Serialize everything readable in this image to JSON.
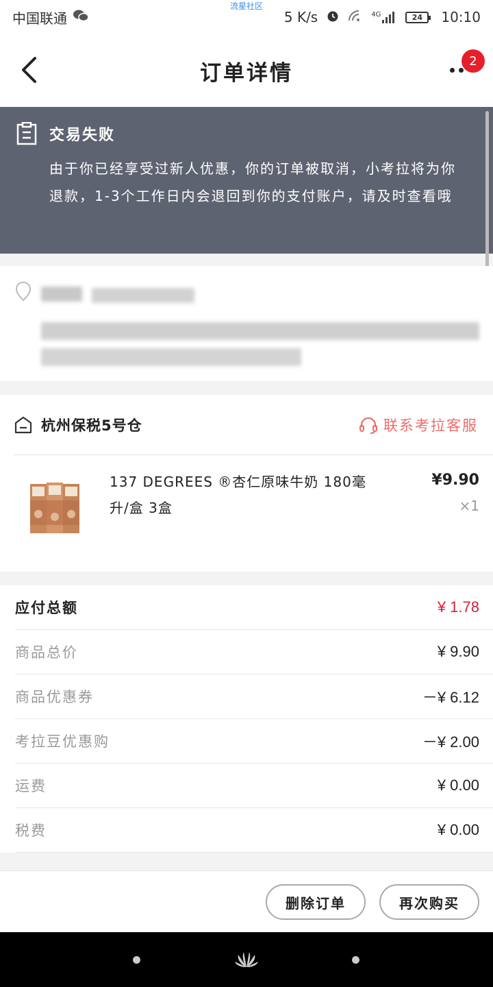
{
  "status_bar": {
    "carrier": "中国联通",
    "center_label": "流星社区",
    "speed": "5 K/s",
    "network": "4G",
    "battery": "24",
    "time": "10:10"
  },
  "nav": {
    "title": "订单详情",
    "badge_count": "2"
  },
  "banner": {
    "title": "交易失败",
    "message": "由于你已经享受过新人优惠，你的订单被取消，小考拉将为你退款，1-3个工作日内会退回到你的支付账户，请及时查看哦"
  },
  "store": {
    "name": "杭州保税5号仓",
    "service_label": "联系考拉客服"
  },
  "product": {
    "name": "137 DEGREES ®杏仁原味牛奶 180毫升/盒 3盒",
    "price": "¥9.90",
    "quantity": "×1"
  },
  "prices": {
    "total": {
      "label": "应付总额",
      "value": "¥ 1.78"
    },
    "rows": [
      {
        "label": "商品总价",
        "value": "¥ 9.90"
      },
      {
        "label": "商品优惠券",
        "value": "－¥ 6.12"
      },
      {
        "label": "考拉豆优惠购",
        "value": "－¥ 2.00"
      },
      {
        "label": "运费",
        "value": "¥ 0.00"
      },
      {
        "label": "税费",
        "value": "¥ 0.00"
      }
    ]
  },
  "actions": {
    "delete_label": "删除订单",
    "rebuy_label": "再次购买"
  },
  "colors": {
    "banner_bg": "#5e6371",
    "accent_red": "#d0233b",
    "service_red": "#ef6c6c"
  },
  "icons": [
    "chevron-left-icon",
    "more-dots-icon",
    "clipboard-icon",
    "location-pin-icon",
    "warehouse-icon",
    "headset-icon",
    "huawei-logo-icon"
  ]
}
